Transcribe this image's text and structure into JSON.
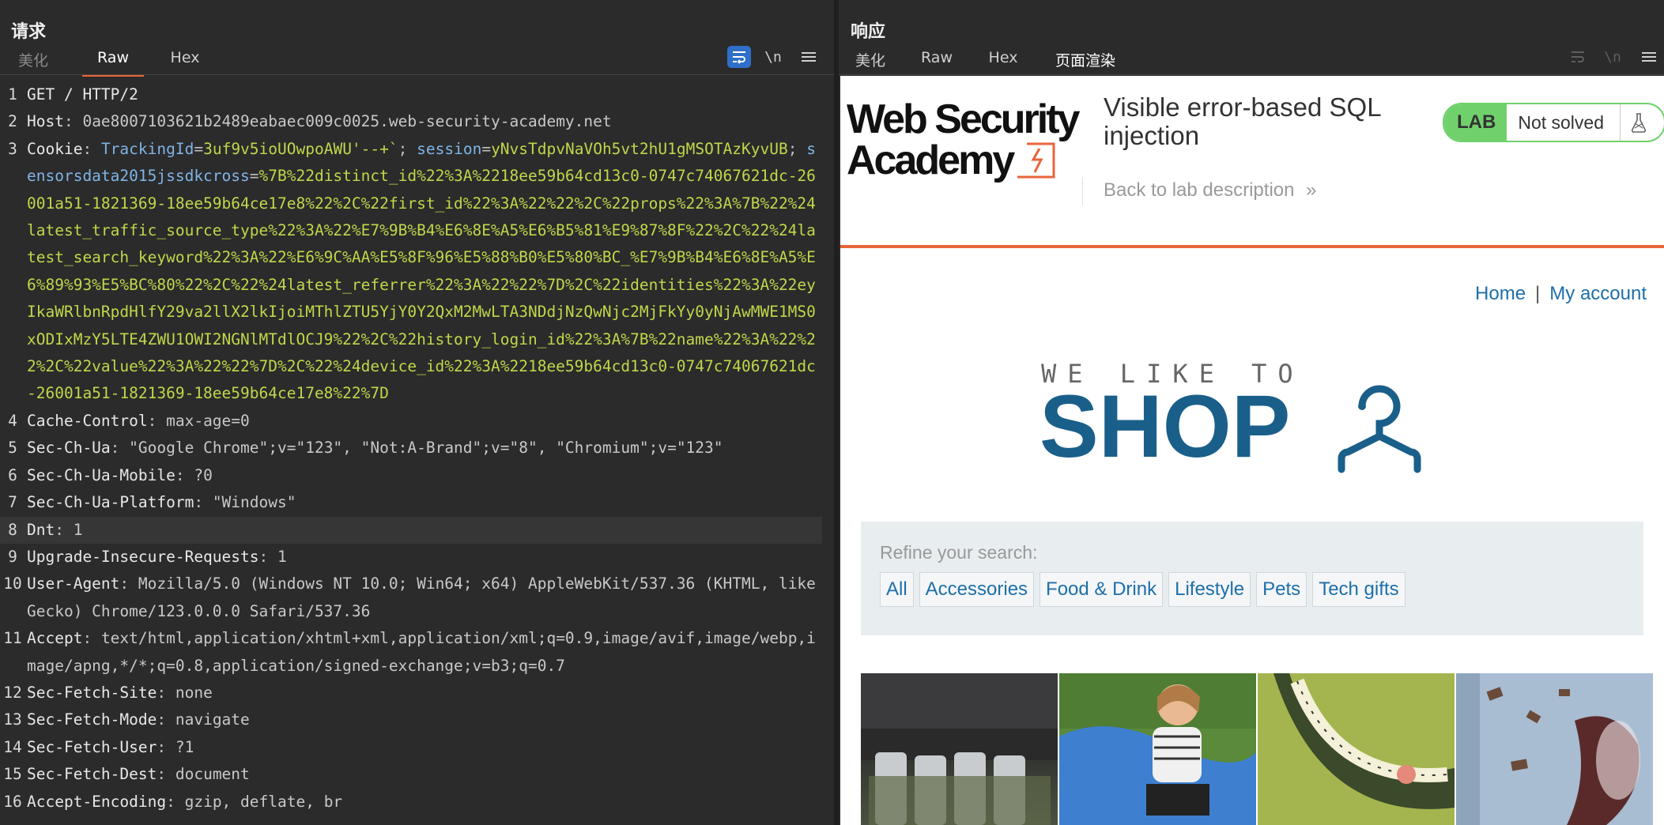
{
  "request": {
    "title": "请求",
    "tabs": [
      {
        "label": "美化",
        "state": "dim"
      },
      {
        "label": "Raw",
        "state": "active"
      },
      {
        "label": "Hex",
        "state": "normal"
      }
    ],
    "toolbar": {
      "newline_label": "\\n"
    },
    "lines": [
      {
        "n": "1",
        "parts": [
          {
            "t": "GET / HTTP/2",
            "c": "hk"
          }
        ]
      },
      {
        "n": "2",
        "parts": [
          {
            "t": "Host",
            "c": "hk"
          },
          {
            "t": ": ",
            "c": "pl"
          },
          {
            "t": "0ae8007103621b2489eabaec009c0025.web-security-academy.net",
            "c": "hv"
          }
        ]
      },
      {
        "n": "3",
        "parts": [
          {
            "t": "Cookie",
            "c": "hk"
          },
          {
            "t": ": ",
            "c": "pl"
          },
          {
            "t": "TrackingId",
            "c": "ck"
          },
          {
            "t": "=",
            "c": "pl"
          },
          {
            "t": "3uf9v5ioUOwpoAWU'--+`",
            "c": "cv"
          },
          {
            "t": "; ",
            "c": "pl"
          },
          {
            "t": "session",
            "c": "ck"
          },
          {
            "t": "=",
            "c": "pl"
          },
          {
            "t": "yNvsTdpvNaVOh5vt2hU1gMSOTAzKyvUB",
            "c": "cv"
          },
          {
            "t": "; ",
            "c": "pl"
          },
          {
            "t": "sensorsdata2015jssdkcross",
            "c": "ck"
          },
          {
            "t": "=",
            "c": "pl"
          },
          {
            "t": "%7B%22distinct_id%22%3A%2218ee59b64cd13c0-0747c74067621dc-26001a51-1821369-18ee59b64ce17e8%22%2C%22first_id%22%3A%22%22%2C%22props%22%3A%7B%22%24latest_traffic_source_type%22%3A%22%E7%9B%B4%E6%8E%A5%E6%B5%81%E9%87%8F%22%2C%22%24latest_search_keyword%22%3A%22%E6%9C%AA%E5%8F%96%E5%88%B0%E5%80%BC_%E7%9B%B4%E6%8E%A5%E6%89%93%E5%BC%80%22%2C%22%24latest_referrer%22%3A%22%22%7D%2C%22identities%22%3A%22eyIkaWRlbnRpdHlfY29va2llX2lkIjoiMThlZTU5YjY0Y2QxM2MwLTA3NDdjNzQwNjc2MjFkYy0yNjAwMWE1MS0xODIxMzY5LTE4ZWU1OWI2NGNlMTdlOCJ9%22%2C%22history_login_id%22%3A%7B%22name%22%3A%22%22%2C%22value%22%3A%22%22%7D%2C%22%24device_id%22%3A%2218ee59b64cd13c0-0747c74067621dc-26001a51-1821369-18ee59b64ce17e8%22%7D",
            "c": "cv"
          }
        ]
      },
      {
        "n": "4",
        "parts": [
          {
            "t": "Cache-Control",
            "c": "hk"
          },
          {
            "t": ": ",
            "c": "pl"
          },
          {
            "t": "max-age=0",
            "c": "hv"
          }
        ]
      },
      {
        "n": "5",
        "parts": [
          {
            "t": "Sec-Ch-Ua",
            "c": "hk"
          },
          {
            "t": ": ",
            "c": "pl"
          },
          {
            "t": "\"Google Chrome\";v=\"123\", \"Not:A-Brand\";v=\"8\", \"Chromium\";v=\"123\"",
            "c": "hv"
          }
        ]
      },
      {
        "n": "6",
        "parts": [
          {
            "t": "Sec-Ch-Ua-Mobile",
            "c": "hk"
          },
          {
            "t": ": ",
            "c": "pl"
          },
          {
            "t": "?0",
            "c": "hv"
          }
        ]
      },
      {
        "n": "7",
        "parts": [
          {
            "t": "Sec-Ch-Ua-Platform",
            "c": "hk"
          },
          {
            "t": ": ",
            "c": "pl"
          },
          {
            "t": "\"Windows\"",
            "c": "hv"
          }
        ]
      },
      {
        "n": "8",
        "hl": true,
        "parts": [
          {
            "t": "Dnt",
            "c": "hk"
          },
          {
            "t": ": ",
            "c": "pl"
          },
          {
            "t": "1",
            "c": "hv"
          }
        ]
      },
      {
        "n": "9",
        "parts": [
          {
            "t": "Upgrade-Insecure-Requests",
            "c": "hk"
          },
          {
            "t": ": ",
            "c": "pl"
          },
          {
            "t": "1",
            "c": "hv"
          }
        ]
      },
      {
        "n": "10",
        "parts": [
          {
            "t": "User-Agent",
            "c": "hk"
          },
          {
            "t": ": ",
            "c": "pl"
          },
          {
            "t": "Mozilla/5.0 (Windows NT 10.0; Win64; x64) AppleWebKit/537.36 (KHTML, like Gecko) Chrome/123.0.0.0 Safari/537.36",
            "c": "hv"
          }
        ]
      },
      {
        "n": "11",
        "parts": [
          {
            "t": "Accept",
            "c": "hk"
          },
          {
            "t": ": ",
            "c": "pl"
          },
          {
            "t": "text/html,application/xhtml+xml,application/xml;q=0.9,image/avif,image/webp,image/apng,*/*;q=0.8,application/signed-exchange;v=b3;q=0.7",
            "c": "hv"
          }
        ]
      },
      {
        "n": "12",
        "parts": [
          {
            "t": "Sec-Fetch-Site",
            "c": "hk"
          },
          {
            "t": ": ",
            "c": "pl"
          },
          {
            "t": "none",
            "c": "hv"
          }
        ]
      },
      {
        "n": "13",
        "parts": [
          {
            "t": "Sec-Fetch-Mode",
            "c": "hk"
          },
          {
            "t": ": ",
            "c": "pl"
          },
          {
            "t": "navigate",
            "c": "hv"
          }
        ]
      },
      {
        "n": "14",
        "parts": [
          {
            "t": "Sec-Fetch-User",
            "c": "hk"
          },
          {
            "t": ": ",
            "c": "pl"
          },
          {
            "t": "?1",
            "c": "hv"
          }
        ]
      },
      {
        "n": "15",
        "parts": [
          {
            "t": "Sec-Fetch-Dest",
            "c": "hk"
          },
          {
            "t": ": ",
            "c": "pl"
          },
          {
            "t": "document",
            "c": "hv"
          }
        ]
      },
      {
        "n": "16",
        "parts": [
          {
            "t": "Accept-Encoding",
            "c": "hk"
          },
          {
            "t": ": ",
            "c": "pl"
          },
          {
            "t": "gzip, deflate, br",
            "c": "hv"
          }
        ]
      }
    ]
  },
  "response": {
    "title": "响应",
    "tabs": [
      {
        "label": "美化",
        "state": "normal"
      },
      {
        "label": "Raw",
        "state": "normal"
      },
      {
        "label": "Hex",
        "state": "normal"
      },
      {
        "label": "页面渲染",
        "state": "active"
      }
    ],
    "toolbar": {
      "newline_label": "\\n"
    },
    "page": {
      "logo_line1": "Web Security",
      "logo_line2": "Academy",
      "lab_title": "Visible error-based SQL injection",
      "back_link": "Back to lab description",
      "lab_badge": "LAB",
      "lab_status": "Not solved",
      "nav": {
        "home": "Home",
        "sep": "|",
        "account": "My account"
      },
      "shop_tagline": "WE LIKE TO",
      "shop_word": "SHOP",
      "refine_label": "Refine your search:",
      "filters": [
        "All",
        "Accessories",
        "Food & Drink",
        "Lifestyle",
        "Pets",
        "Tech gifts"
      ]
    }
  },
  "colors": {
    "accent_orange": "#e8653b",
    "lab_green": "#70d16c",
    "link_blue": "#1e6fa8",
    "shop_blue": "#1a5f8a",
    "cookie_name": "#7fb4e6",
    "cookie_value": "#c2d64a"
  },
  "icons": [
    "wrap-lines-icon",
    "newline-icon",
    "menu-icon",
    "layout-split-icon",
    "layout-rows-icon",
    "layout-single-icon",
    "flask-icon",
    "chevron-double-right-icon"
  ]
}
